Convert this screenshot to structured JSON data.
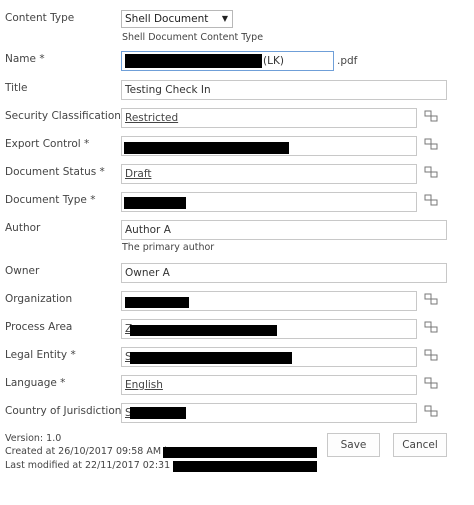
{
  "content_type": {
    "label": "Content Type",
    "value": "Shell Document",
    "caption": "Shell Document Content Type"
  },
  "name": {
    "label": "Name *",
    "suffix": "(LK)",
    "extension": ".pdf"
  },
  "title": {
    "label": "Title",
    "value": "Testing Check In"
  },
  "security": {
    "label": "Security Classification *",
    "value": "Restricted"
  },
  "export": {
    "label": "Export Control *"
  },
  "status": {
    "label": "Document Status *",
    "value": "Draft"
  },
  "doctype": {
    "label": "Document Type *"
  },
  "author": {
    "label": "Author",
    "value": "Author A",
    "caption": "The primary author"
  },
  "owner": {
    "label": "Owner",
    "value": "Owner A"
  },
  "organization": {
    "label": "Organization"
  },
  "process": {
    "label": "Process Area",
    "prefix": "Z"
  },
  "legal": {
    "label": "Legal Entity *",
    "prefix": "S"
  },
  "language": {
    "label": "Language *",
    "value": "English"
  },
  "country": {
    "label": "Country of Jurisdiction *",
    "prefix": "S"
  },
  "footer": {
    "version": "Version: 1.0",
    "created": "Created at 26/10/2017 09:58 AM  by",
    "modified": "Last modified at 22/11/2017 02:31 AM"
  },
  "buttons": {
    "save": "Save",
    "cancel": "Cancel"
  },
  "icons": {
    "term_picker": "taxonomy-picker-icon",
    "dropdown": "dropdown-arrow-icon"
  }
}
